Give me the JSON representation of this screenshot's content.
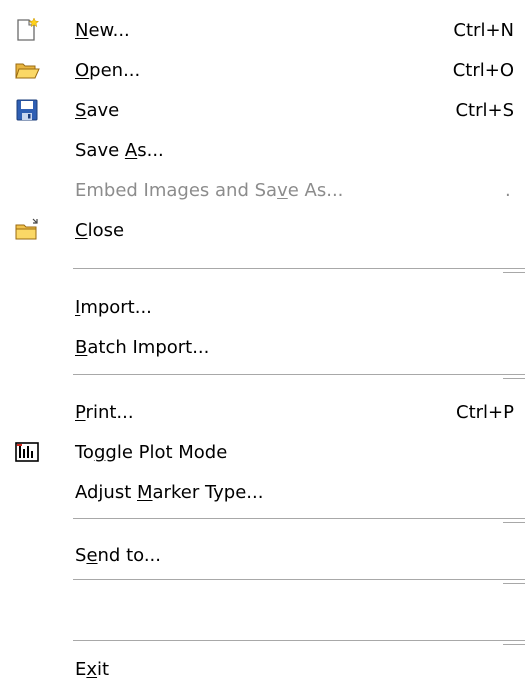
{
  "menu": {
    "items": {
      "new": {
        "pre": "",
        "u": "N",
        "post": "ew...",
        "shortcut": "Ctrl+N",
        "icon": "new-document-icon"
      },
      "open": {
        "pre": "",
        "u": "O",
        "post": "pen...",
        "shortcut": "Ctrl+O",
        "icon": "open-folder-icon"
      },
      "save": {
        "pre": "",
        "u": "S",
        "post": "ave",
        "shortcut": "Ctrl+S",
        "icon": "floppy-disk-icon"
      },
      "save_as": {
        "pre": "Save ",
        "u": "A",
        "post": "s..."
      },
      "embed_save_as": {
        "pre": "Embed Images and Sa",
        "u": "v",
        "post": "e As...",
        "trail": "."
      },
      "close": {
        "pre": "",
        "u": "C",
        "post": "lose",
        "icon": "close-folder-icon"
      },
      "import": {
        "pre": "",
        "u": "I",
        "post": "mport..."
      },
      "batch_import": {
        "pre": "",
        "u": "B",
        "post": "atch Import..."
      },
      "print": {
        "pre": "",
        "u": "P",
        "post": "rint...",
        "shortcut": "Ctrl+P"
      },
      "toggle_plot_mode": {
        "pre": "To",
        "u": "g",
        "post": "gle Plot Mode",
        "icon": "plot-mode-icon"
      },
      "adjust_marker_type": {
        "pre": "Adjust ",
        "u": "M",
        "post": "arker Type..."
      },
      "send_to": {
        "pre": "S",
        "u": "e",
        "post": "nd to..."
      },
      "exit": {
        "pre": "E",
        "u": "x",
        "post": "it"
      }
    }
  }
}
